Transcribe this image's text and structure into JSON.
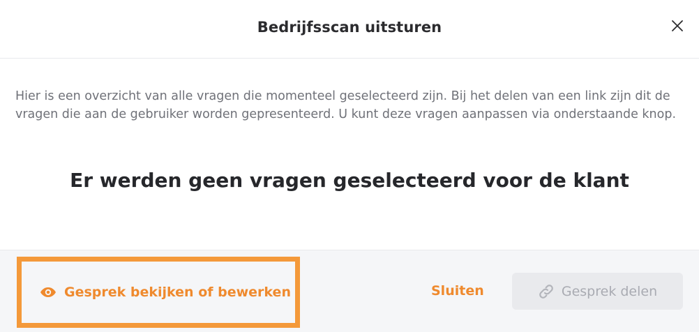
{
  "header": {
    "title": "Bedrijfsscan uitsturen",
    "close_icon": "close-icon"
  },
  "body": {
    "intro": "Hier is een overzicht van alle vragen die momenteel geselecteerd zijn. Bij het delen van een link zijn dit de vragen die aan de gebruiker worden gepresenteerd. U kunt deze vragen aanpassen via onderstaande knop.",
    "empty_message": "Er werden geen vragen geselecteerd voor de klant"
  },
  "footer": {
    "view_button": {
      "label": "Gesprek bekijken of bewerken",
      "icon": "eye-icon"
    },
    "close_label": "Sluiten",
    "share_button": {
      "label": "Gesprek delen",
      "icon": "link-icon",
      "disabled": true
    }
  },
  "colors": {
    "accent": "#ef8a2e",
    "highlight_border": "#f4993a",
    "disabled_bg": "#e9eaed",
    "disabled_text": "#a9abb2",
    "footer_bg": "#f5f6f8"
  }
}
